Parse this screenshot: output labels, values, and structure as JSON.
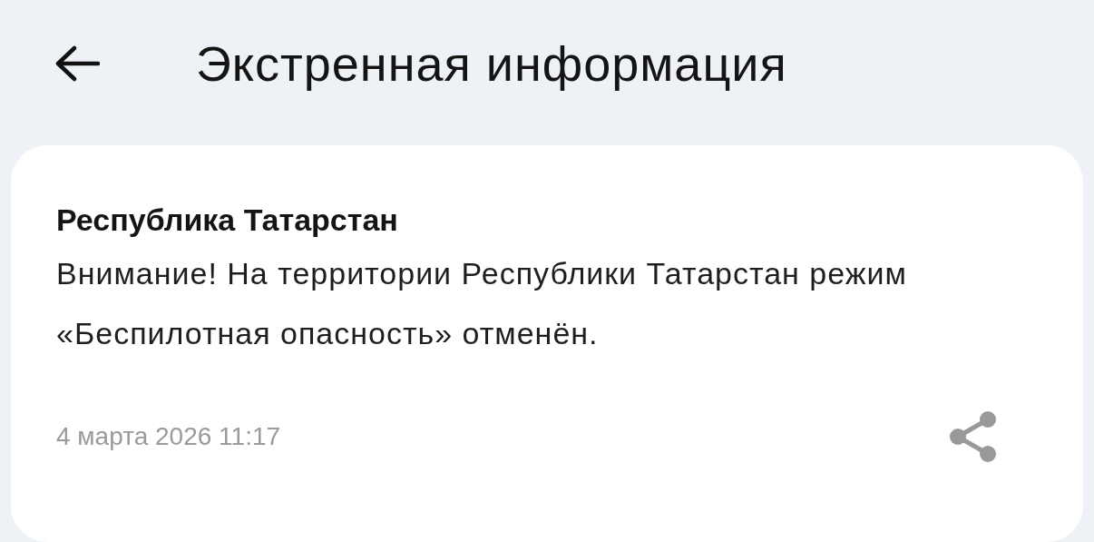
{
  "header": {
    "title": "Экстренная информация"
  },
  "alert": {
    "region": "Республика Татарстан",
    "message": "Внимание! На территории Республики Татарстан режим «Беспилотная опасность» отменён.",
    "date": "4 марта 2026 11:17"
  }
}
